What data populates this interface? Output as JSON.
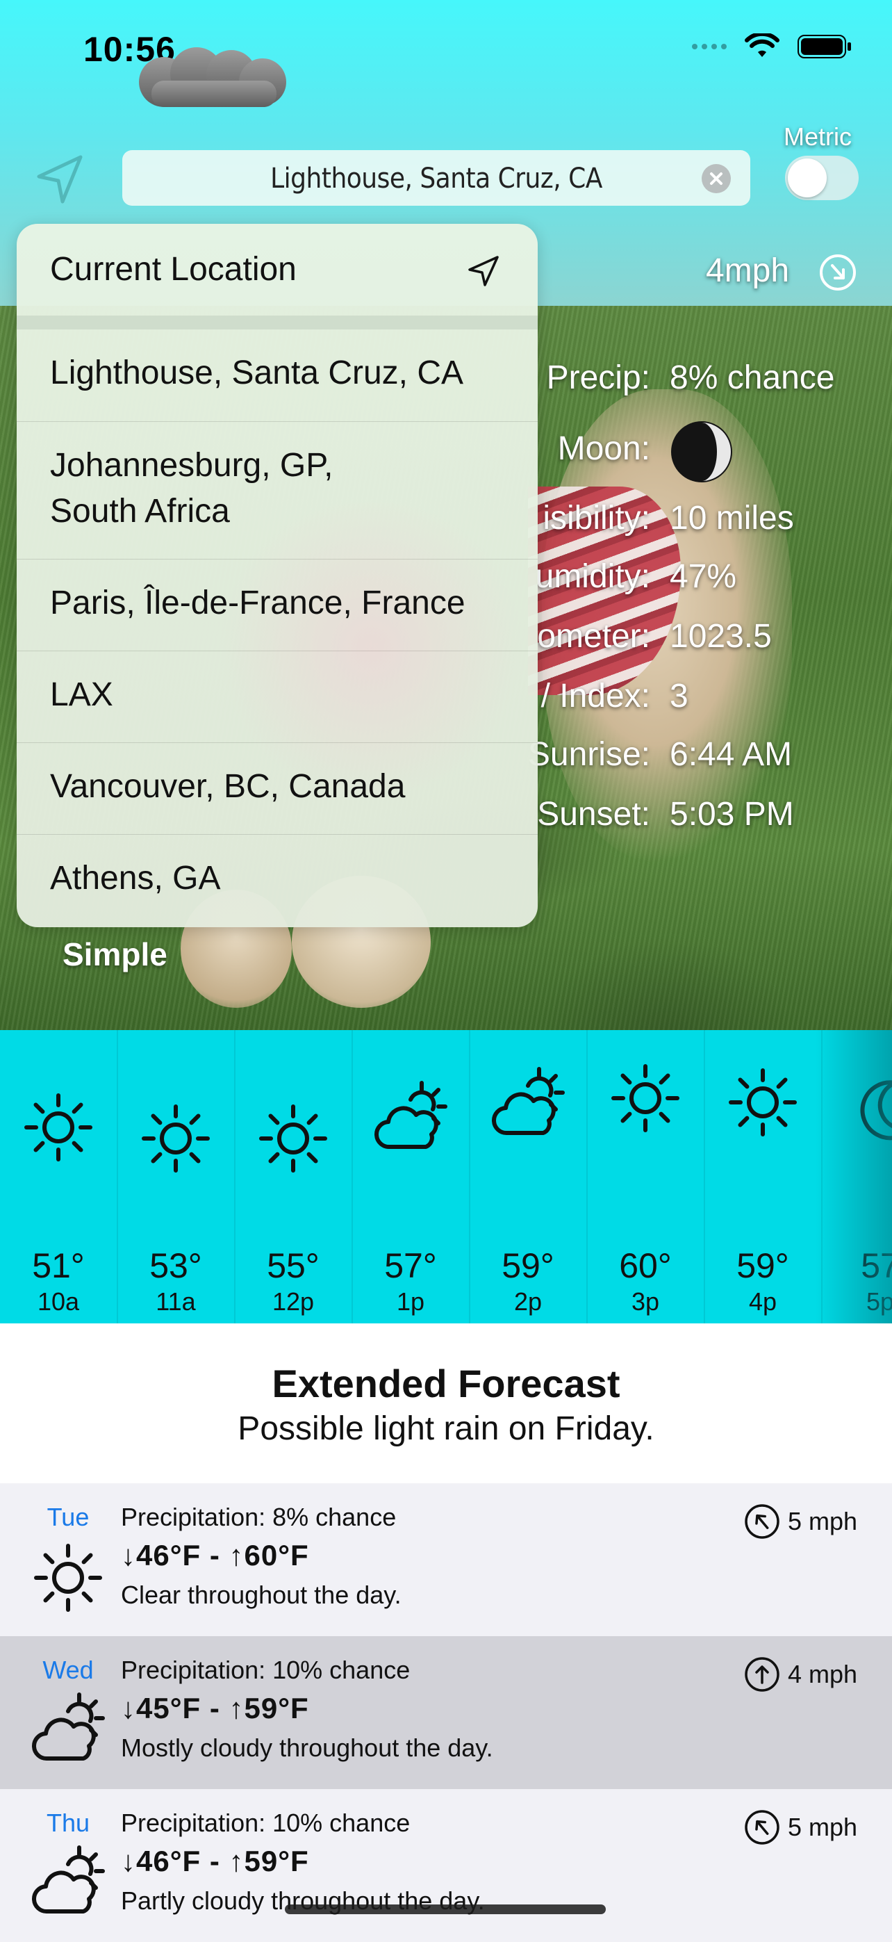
{
  "status_bar": {
    "time": "10:56"
  },
  "header": {
    "search_value": "Lighthouse, Santa Cruz, CA",
    "metric_label": "Metric",
    "metric_on": false
  },
  "current": {
    "wind": "4mph",
    "details": [
      {
        "label": "Precip:",
        "value": "8% chance"
      },
      {
        "label": "Moon:",
        "value": ""
      },
      {
        "label": "isibility:",
        "value": "10 miles"
      },
      {
        "label": "umidity:",
        "value": "47%"
      },
      {
        "label": "ometer:",
        "value": "1023.5"
      },
      {
        "label": "/ Index:",
        "value": "3"
      },
      {
        "label": "Sunrise:",
        "value": "6:44 AM"
      },
      {
        "label": "Sunset:",
        "value": "5:03 PM"
      }
    ]
  },
  "dropdown": {
    "current_location": "Current Location",
    "items": [
      {
        "label": "Lighthouse, Santa Cruz, CA"
      },
      {
        "label_line1": "Johannesburg, GP,",
        "label_line2": "South Africa"
      },
      {
        "label": "Paris, Île-de-France, France"
      },
      {
        "label": "LAX"
      },
      {
        "label": "Vancouver, BC, Canada"
      },
      {
        "label": "Athens, GA"
      }
    ]
  },
  "simple_link": "Simple",
  "hourly": [
    {
      "icon": "sun-icon",
      "temp": "51°",
      "time": "10a"
    },
    {
      "icon": "sun-icon",
      "temp": "53°",
      "time": "11a"
    },
    {
      "icon": "sun-icon",
      "temp": "55°",
      "time": "12p"
    },
    {
      "icon": "partly-cloudy-icon",
      "temp": "57°",
      "time": "1p"
    },
    {
      "icon": "partly-cloudy-icon",
      "temp": "59°",
      "time": "2p"
    },
    {
      "icon": "sun-icon",
      "temp": "60°",
      "time": "3p"
    },
    {
      "icon": "sun-icon",
      "temp": "59°",
      "time": "4p"
    },
    {
      "icon": "moon-icon",
      "temp": "57",
      "time": "5p"
    }
  ],
  "extended": {
    "title": "Extended Forecast",
    "subtitle": "Possible light rain on Friday.",
    "days": [
      {
        "day": "Tue",
        "icon": "sun-icon",
        "precip": "Precipitation: 8% chance",
        "temps": "↓46°F - ↑60°F",
        "desc": "Clear throughout the day.",
        "wind": "5 mph",
        "bg": "#f1f1f6"
      },
      {
        "day": "Wed",
        "icon": "partly-cloudy-icon",
        "precip": "Precipitation: 10% chance",
        "temps": "↓45°F - ↑59°F",
        "desc": "Mostly cloudy throughout the day.",
        "wind": "4 mph",
        "bg": "#d2d2d8"
      },
      {
        "day": "Thu",
        "icon": "partly-cloudy-icon",
        "precip": "Precipitation: 10% chance",
        "temps": "↓46°F - ↑59°F",
        "desc": "Partly cloudy throughout the day.",
        "wind": "5 mph",
        "bg": "#f1f1f6"
      }
    ]
  },
  "colors": {
    "accent_blue": "#1a7ae8",
    "hourly_bg": "#00dbe6"
  }
}
